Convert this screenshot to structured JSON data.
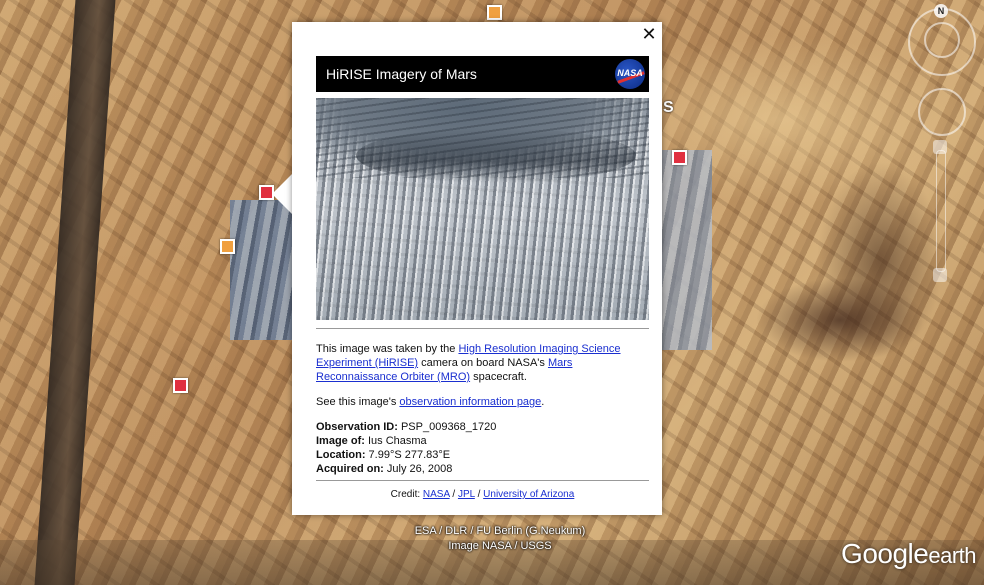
{
  "balloon": {
    "header_title": "HiRISE Imagery of Mars",
    "logo_text": "NASA",
    "close_symbol": "✕",
    "description": {
      "prefix": "This image was taken by the ",
      "link1": "High Resolution Imaging Science Experiment (HiRISE)",
      "mid": " camera on board NASA's ",
      "link2": "Mars Reconnaissance Orbiter (MRO)",
      "suffix": " spacecraft."
    },
    "see_prefix": "See this image's ",
    "see_link": "observation information page",
    "see_suffix": ".",
    "meta": [
      {
        "label": "Observation ID:",
        "value": " PSP_009368_1720"
      },
      {
        "label": "Image of:",
        "value": " Ius Chasma"
      },
      {
        "label": "Location:",
        "value": " 7.99°S 277.83°E"
      },
      {
        "label": "Acquired on:",
        "value": " July 26, 2008"
      }
    ],
    "credit_prefix": "Credit: ",
    "credit_links": [
      "NASA",
      "JPL",
      "University of Arizona"
    ],
    "credit_sep": " / "
  },
  "map": {
    "attribution_line1": "ESA / DLR / FU Berlin (G.Neukum)",
    "attribution_line2": "Image NASA / USGS",
    "logo_google": "Google",
    "logo_earth": "earth",
    "compass_n": "N",
    "side_letter": "S"
  },
  "colors": {
    "marker_orange": "#f0a040",
    "marker_red": "#e03040",
    "link": "#1a2fd0"
  }
}
